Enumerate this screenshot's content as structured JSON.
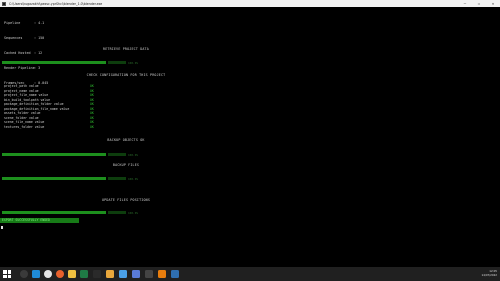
{
  "window": {
    "title": "C:\\Users\\kugazakhi\\pexsc.yprShcl\\blender_1.0\\blender.exe",
    "controls": [
      "—",
      "☐",
      "✕"
    ]
  },
  "info": [
    {
      "key": "Pipeline",
      "value": ": 4.1"
    },
    {
      "key": "Sequences",
      "value": ": 150"
    },
    {
      "key": "Cached Hosted",
      "value": ": 12"
    },
    {
      "key": "Render Pipeline",
      "value": ": 3"
    },
    {
      "key": "Frames/sec",
      "value": ": 0.045"
    }
  ],
  "sections": {
    "retrieve": "RETRIEVE PROJECT DATA",
    "checks_header": "CHECK CONFIGURATION FOR THIS PROJECT",
    "backup_objects": "BACKUP OBJECTS OK",
    "backup_files": "BACKUP FILES",
    "update": "UPDATE FILES POSITIONS"
  },
  "progress": [
    {
      "value": "100.0%"
    },
    {
      "value": "100.0%"
    },
    {
      "value": "100.0%"
    },
    {
      "value": "100.0%"
    }
  ],
  "checks": [
    {
      "label": "project_path value",
      "status": "OK"
    },
    {
      "label": "project_name value",
      "status": "OK"
    },
    {
      "label": "project_file_name value",
      "status": "OK"
    },
    {
      "label": "bin_build_toolpath value",
      "status": "OK"
    },
    {
      "label": "package_definition_folder value",
      "status": "OK"
    },
    {
      "label": "package_definition_file_name value",
      "status": "OK"
    },
    {
      "label": "assets_folder value",
      "status": "OK"
    },
    {
      "label": "scene_folder value",
      "status": "OK"
    },
    {
      "label": "scene_file_name value",
      "status": "OK"
    },
    {
      "label": "textures_folder value",
      "status": "OK"
    }
  ],
  "success_message": "EXPORT SUCCESSFULLY ENDED",
  "taskbar": {
    "apps": [
      {
        "icon": "search-icon",
        "color": "#3a3a3a"
      },
      {
        "icon": "edge-icon",
        "color": "#1f8bd6"
      },
      {
        "icon": "chrome-icon",
        "color": "#e5e5e5"
      },
      {
        "icon": "firefox-icon",
        "color": "#e8612c"
      },
      {
        "icon": "files-icon",
        "color": "#f0c040"
      },
      {
        "icon": "excel-icon",
        "color": "#1f7a45"
      },
      {
        "icon": "terminal-icon",
        "color": "#2a2a2a"
      },
      {
        "icon": "paint-icon",
        "color": "#e9a83c"
      },
      {
        "icon": "image-icon",
        "color": "#4aa0e8"
      },
      {
        "icon": "chat-icon",
        "color": "#5a7bd8"
      },
      {
        "icon": "cmd-icon",
        "color": "#444444"
      },
      {
        "icon": "blender-icon",
        "color": "#e87d0d"
      },
      {
        "icon": "steam-icon",
        "color": "#2f6fb0"
      }
    ],
    "time": "12:05",
    "date": "14/07/2022"
  }
}
